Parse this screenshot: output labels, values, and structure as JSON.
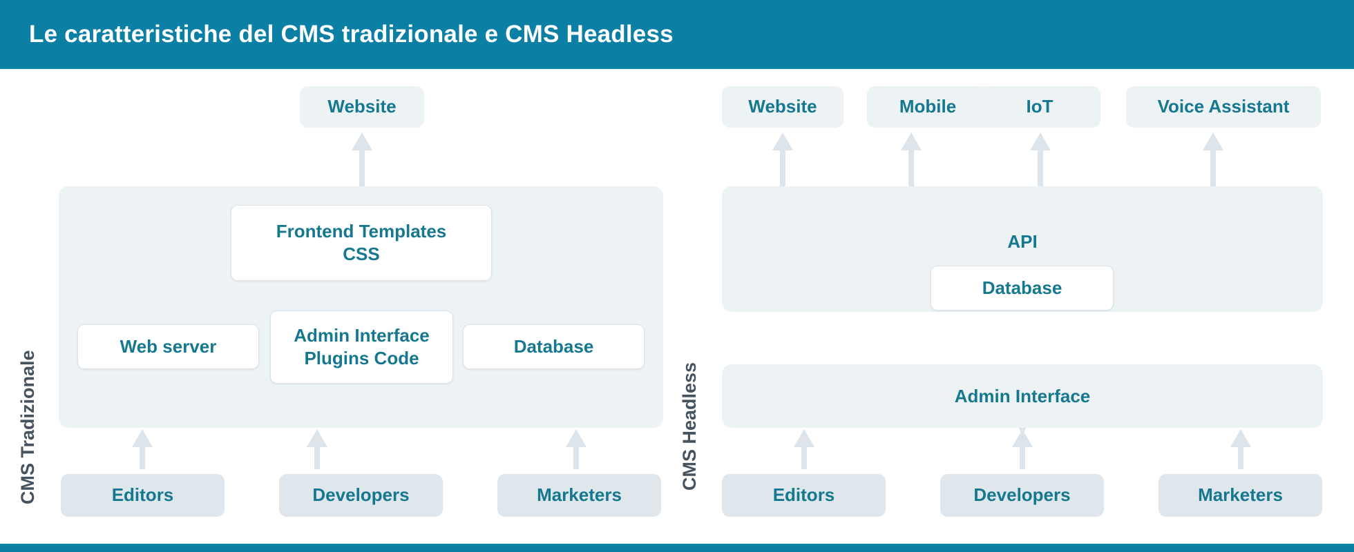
{
  "header": {
    "title": "Le caratteristiche del CMS tradizionale e CMS Headless",
    "bg_color": "#0C7FA4",
    "text_color": "#FFFFFF"
  },
  "footer": {
    "bg_color": "#0C7FA4"
  },
  "theme": {
    "panel_bg": "#EDF2F5",
    "box_white_bg": "#FFFFFF",
    "actor_bg": "#DFE6EC",
    "accent_text": "#15788F",
    "side_label_text": "#46535E",
    "arrow_color": "#DDE4EA"
  },
  "traditional": {
    "side_label": "CMS Tradizionale",
    "channels": [
      {
        "label": "Website"
      }
    ],
    "frontend_box": {
      "line1": "Frontend Templates",
      "line2": "CSS"
    },
    "components": [
      {
        "label": "Web server"
      },
      {
        "line1": "Admin Interface",
        "line2": "Plugins Code"
      },
      {
        "label": "Database"
      }
    ],
    "actors": [
      {
        "label": "Editors"
      },
      {
        "label": "Developers"
      },
      {
        "label": "Marketers"
      }
    ]
  },
  "headless": {
    "side_label": "CMS Headless",
    "channels": [
      {
        "label": "Website"
      },
      {
        "label": "Mobile"
      },
      {
        "label": "IoT"
      },
      {
        "label": "Voice Assistant"
      }
    ],
    "api_panel": {
      "label": "API",
      "database_box": "Database"
    },
    "admin_panel": {
      "label": "Admin Interface"
    },
    "actors": [
      {
        "label": "Editors"
      },
      {
        "label": "Developers"
      },
      {
        "label": "Marketers"
      }
    ]
  }
}
